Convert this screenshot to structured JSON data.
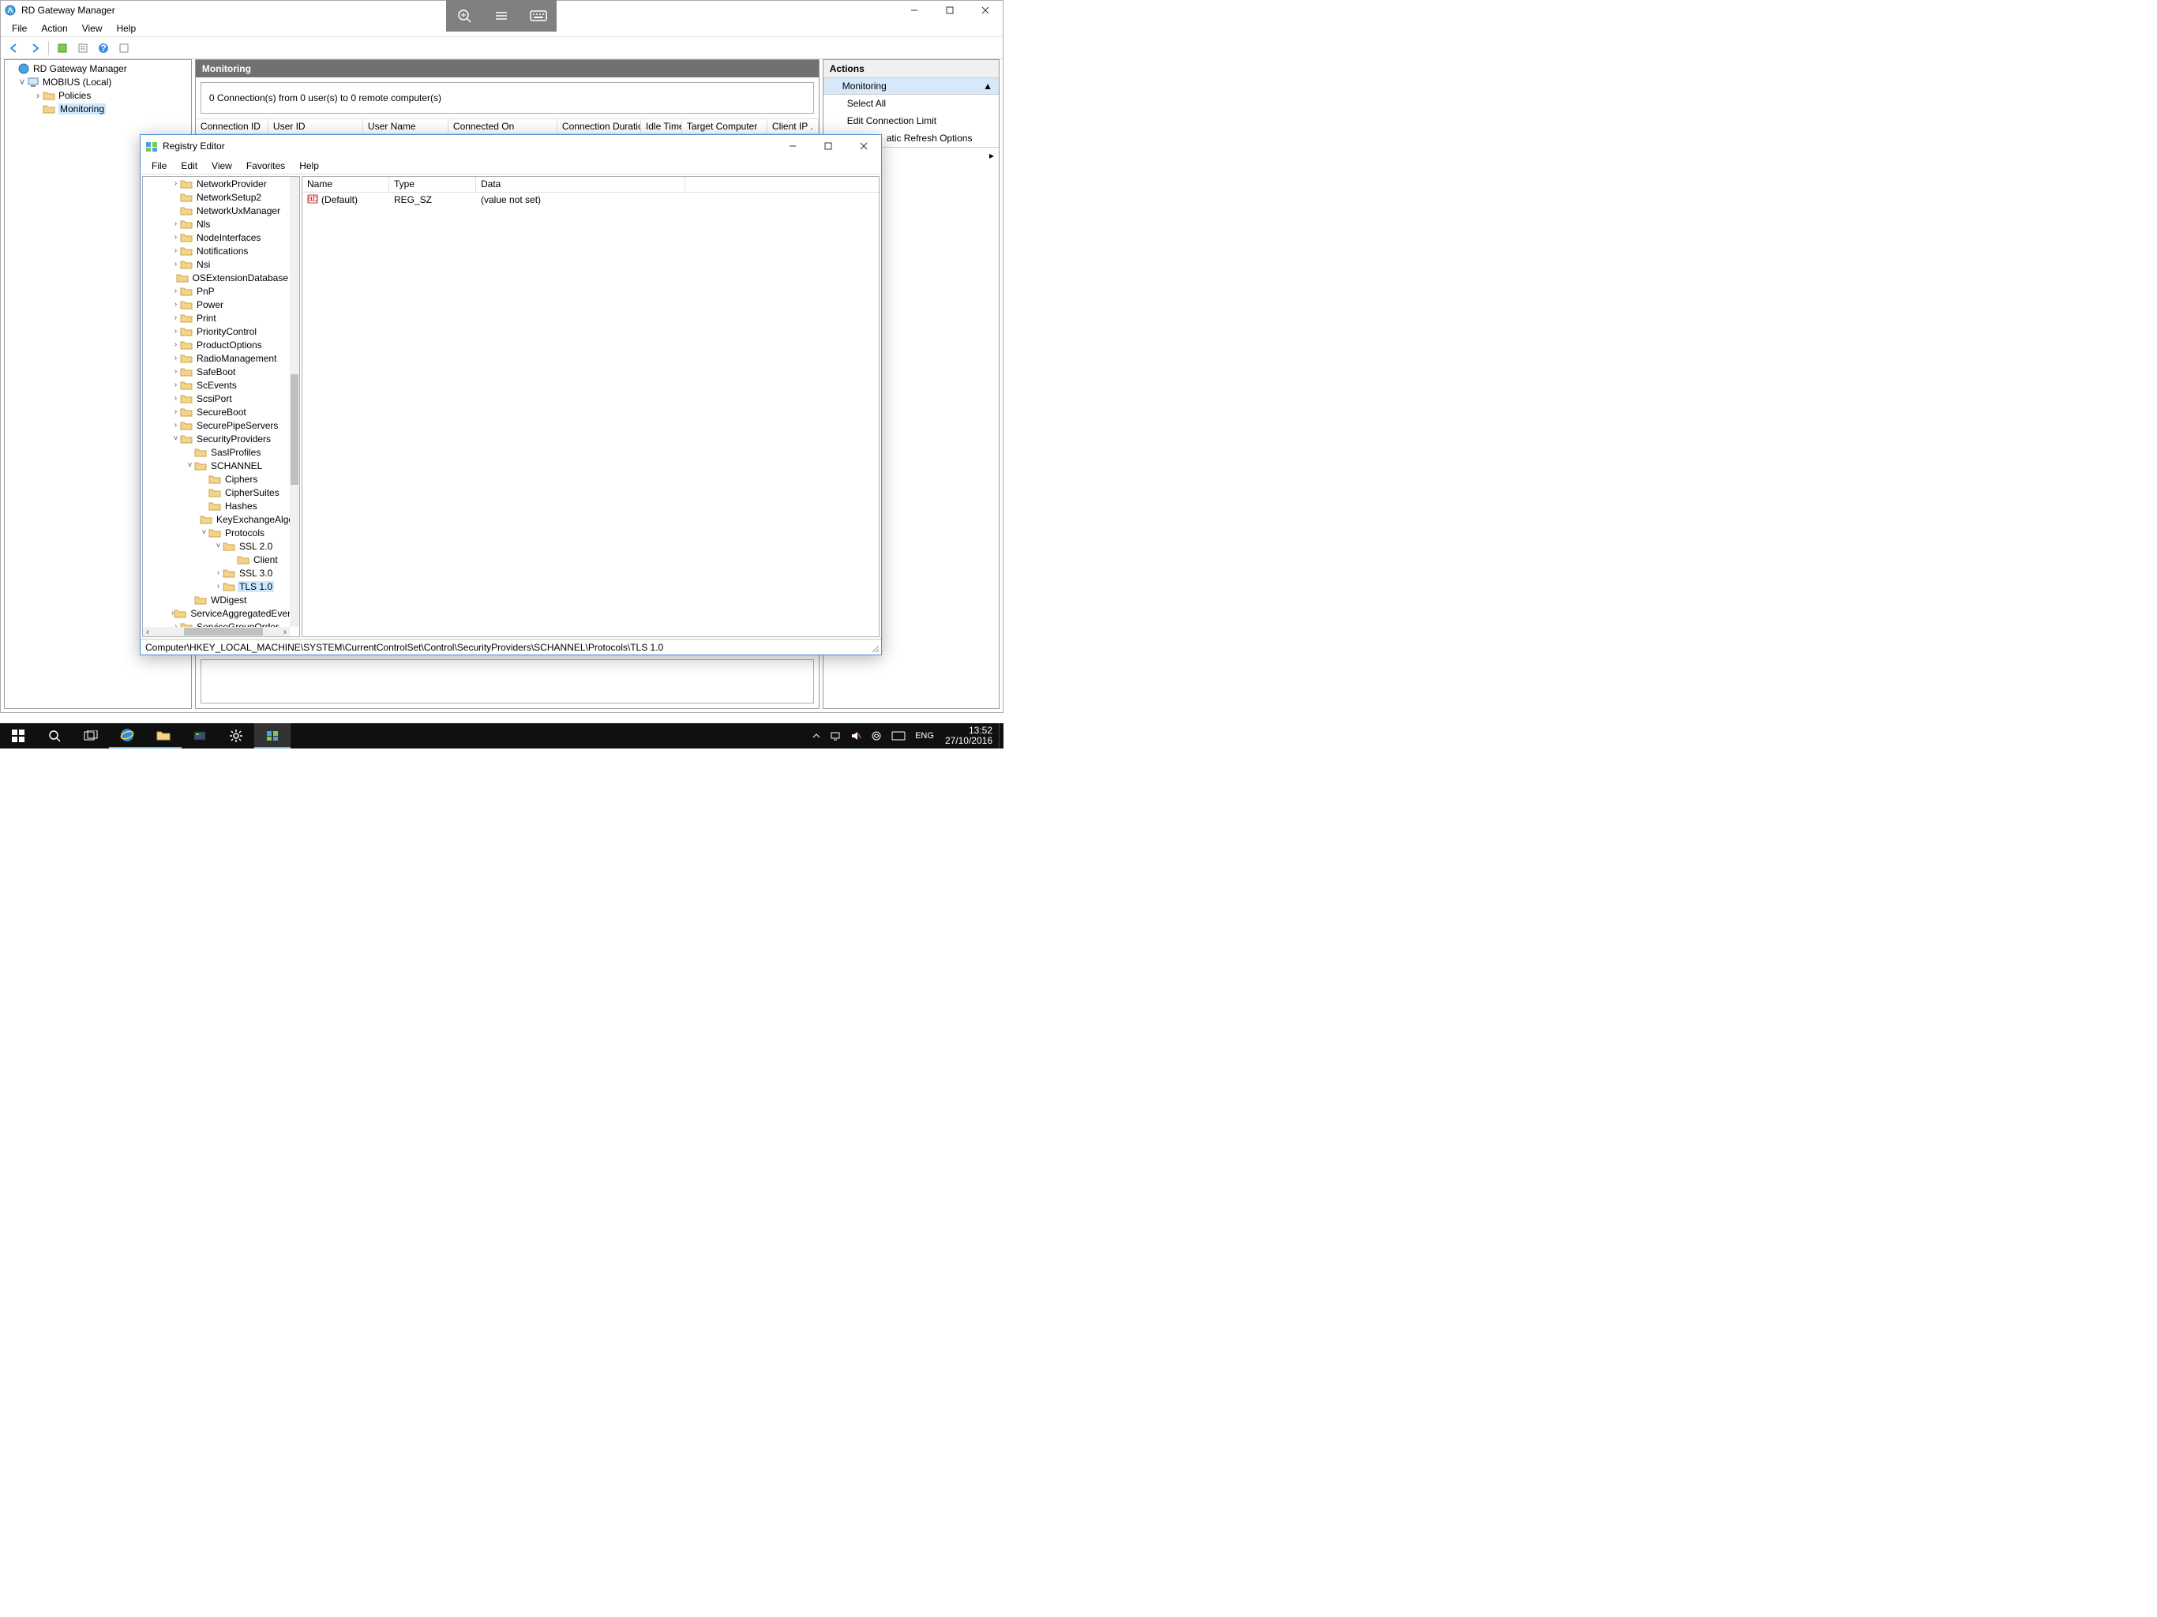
{
  "rdgw": {
    "title": "RD Gateway Manager",
    "menu": {
      "file": "File",
      "action": "Action",
      "view": "View",
      "help": "Help"
    },
    "tree": {
      "root": "RD Gateway Manager",
      "server": "MOBIUS (Local)",
      "policies": "Policies",
      "monitoring": "Monitoring"
    },
    "main": {
      "header": "Monitoring",
      "status": "0 Connection(s) from 0 user(s) to 0 remote computer(s)",
      "columns": [
        "Connection ID",
        "User ID",
        "User Name",
        "Connected On",
        "Connection Duration",
        "Idle Time",
        "Target Computer",
        "Client IP ."
      ]
    },
    "actions": {
      "header": "Actions",
      "section": "Monitoring",
      "items": [
        "Select All",
        "Edit Connection Limit",
        "atic Refresh Options"
      ]
    }
  },
  "regedit": {
    "title": "Registry Editor",
    "menu": {
      "file": "File",
      "edit": "Edit",
      "view": "View",
      "favorites": "Favorites",
      "help": "Help"
    },
    "tree": [
      {
        "indent": 2,
        "expand": ">",
        "label": "NetworkProvider"
      },
      {
        "indent": 2,
        "expand": "",
        "label": "NetworkSetup2"
      },
      {
        "indent": 2,
        "expand": "",
        "label": "NetworkUxManager"
      },
      {
        "indent": 2,
        "expand": ">",
        "label": "Nls"
      },
      {
        "indent": 2,
        "expand": ">",
        "label": "NodeInterfaces"
      },
      {
        "indent": 2,
        "expand": ">",
        "label": "Notifications"
      },
      {
        "indent": 2,
        "expand": ">",
        "label": "Nsi"
      },
      {
        "indent": 2,
        "expand": "",
        "label": "OSExtensionDatabase"
      },
      {
        "indent": 2,
        "expand": ">",
        "label": "PnP"
      },
      {
        "indent": 2,
        "expand": ">",
        "label": "Power"
      },
      {
        "indent": 2,
        "expand": ">",
        "label": "Print"
      },
      {
        "indent": 2,
        "expand": ">",
        "label": "PriorityControl"
      },
      {
        "indent": 2,
        "expand": ">",
        "label": "ProductOptions"
      },
      {
        "indent": 2,
        "expand": ">",
        "label": "RadioManagement"
      },
      {
        "indent": 2,
        "expand": ">",
        "label": "SafeBoot"
      },
      {
        "indent": 2,
        "expand": ">",
        "label": "ScEvents"
      },
      {
        "indent": 2,
        "expand": ">",
        "label": "ScsiPort"
      },
      {
        "indent": 2,
        "expand": ">",
        "label": "SecureBoot"
      },
      {
        "indent": 2,
        "expand": ">",
        "label": "SecurePipeServers"
      },
      {
        "indent": 2,
        "expand": "v",
        "label": "SecurityProviders"
      },
      {
        "indent": 3,
        "expand": "",
        "label": "SaslProfiles"
      },
      {
        "indent": 3,
        "expand": "v",
        "label": "SCHANNEL"
      },
      {
        "indent": 4,
        "expand": "",
        "label": "Ciphers"
      },
      {
        "indent": 4,
        "expand": "",
        "label": "CipherSuites"
      },
      {
        "indent": 4,
        "expand": "",
        "label": "Hashes"
      },
      {
        "indent": 4,
        "expand": "",
        "label": "KeyExchangeAlgor"
      },
      {
        "indent": 4,
        "expand": "v",
        "label": "Protocols"
      },
      {
        "indent": 5,
        "expand": "v",
        "label": "SSL 2.0"
      },
      {
        "indent": 6,
        "expand": "",
        "label": "Client"
      },
      {
        "indent": 5,
        "expand": ">",
        "label": "SSL 3.0"
      },
      {
        "indent": 5,
        "expand": ">",
        "label": "TLS 1.0",
        "selected": true
      },
      {
        "indent": 3,
        "expand": "",
        "label": "WDigest"
      },
      {
        "indent": 2,
        "expand": ">",
        "label": "ServiceAggregatedEvents"
      },
      {
        "indent": 2,
        "expand": ">",
        "label": "ServiceGroupOrder"
      }
    ],
    "list": {
      "columns": {
        "name": "Name",
        "type": "Type",
        "data": "Data"
      },
      "rows": [
        {
          "name": "(Default)",
          "type": "REG_SZ",
          "data": "(value not set)"
        }
      ]
    },
    "statusbar": "Computer\\HKEY_LOCAL_MACHINE\\SYSTEM\\CurrentControlSet\\Control\\SecurityProviders\\SCHANNEL\\Protocols\\TLS 1.0"
  },
  "taskbar": {
    "lang": "ENG",
    "time": "13:52",
    "date": "27/10/2016"
  }
}
